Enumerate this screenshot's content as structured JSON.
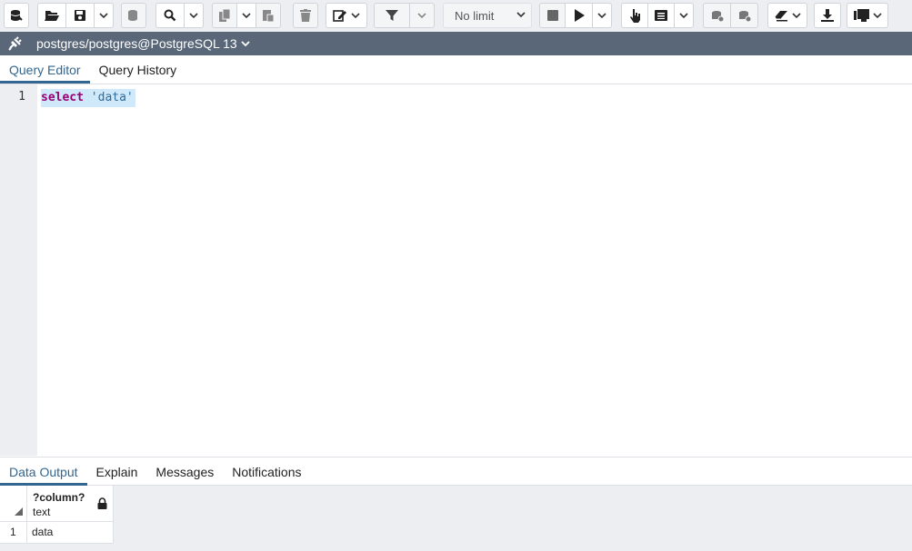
{
  "toolbar": {
    "limit_value": "No limit",
    "icons": [
      "database-icon",
      "folder-open-icon",
      "save-icon",
      "chevron-down-icon",
      "database-edit-icon",
      "search-icon",
      "copy-icon",
      "paste-icon",
      "trash-icon",
      "edit-icon",
      "filter-icon",
      "stop-icon",
      "play-icon",
      "hand-pointer-icon",
      "list-icon",
      "commit-icon",
      "rollback-icon",
      "eraser-icon",
      "download-icon",
      "macro-icon"
    ]
  },
  "connection": {
    "label": "postgres/postgres@PostgreSQL 13"
  },
  "editor_tabs": [
    {
      "label": "Query Editor",
      "active": true
    },
    {
      "label": "Query History",
      "active": false
    }
  ],
  "editor": {
    "line_number": "1",
    "keyword": "select",
    "string": "'data'"
  },
  "output_tabs": [
    {
      "label": "Data Output",
      "active": true
    },
    {
      "label": "Explain",
      "active": false
    },
    {
      "label": "Messages",
      "active": false
    },
    {
      "label": "Notifications",
      "active": false
    }
  ],
  "grid": {
    "column_name": "?column?",
    "column_type": "text",
    "rows": [
      {
        "num": "1",
        "value": "data"
      }
    ]
  },
  "colors": {
    "accent": "#326690",
    "connection_bar": "#596778",
    "keyword": "#990073",
    "string": "#2e6c99"
  }
}
